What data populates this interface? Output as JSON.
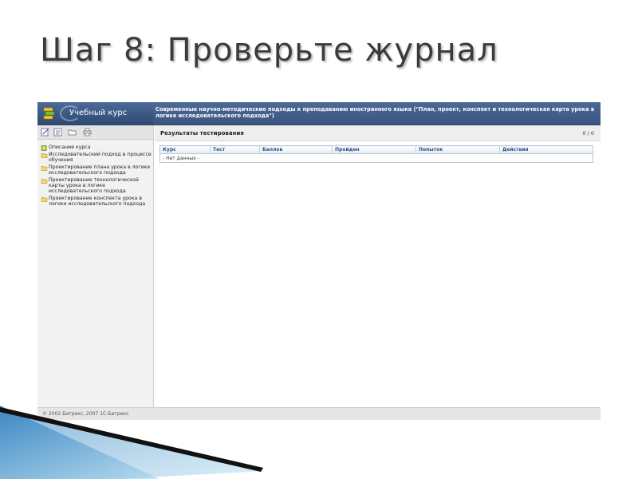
{
  "slide": {
    "title": "Шаг 8: Проверьте журнал"
  },
  "app": {
    "title": "Учебный курс",
    "course_header": "Современные научно-методические подходы к преподаванию иностранного языка (\"План, проект, конспект и технологическая карта урока в логике исследовательского подхода\")"
  },
  "toolbar": {
    "icons": [
      "edit-icon",
      "notes-icon",
      "folder-icon",
      "print-icon"
    ]
  },
  "sidebar": {
    "items": [
      {
        "label": "Описание курса",
        "icon": "page-icon"
      },
      {
        "label": "Исследовательский подход в процессе обучения",
        "icon": "folder-icon"
      },
      {
        "label": "Проектирование плана урока в логике исследовательского подхода",
        "icon": "folder-icon"
      },
      {
        "label": "Проектирование технологической карты урока в логике исследовательского подхода",
        "icon": "folder-icon"
      },
      {
        "label": "Проектирование конспекта урока в логике исследовательского подхода",
        "icon": "folder-icon"
      }
    ]
  },
  "results": {
    "title": "Результаты тестирования",
    "count": "0 / 0",
    "columns": [
      "Курс",
      "Тест",
      "Баллов",
      "Пройден",
      "Попыток",
      "Действия"
    ],
    "empty_text": "- Нет данных -"
  },
  "footer": {
    "text": "© 2002 Битрикс, 2007 1С-Битрикс"
  },
  "colors": {
    "header_blue": "#4d6996",
    "table_header_text": "#2a4f87",
    "decor_dark": "#111111",
    "decor_blue": "#5aa7d6"
  }
}
